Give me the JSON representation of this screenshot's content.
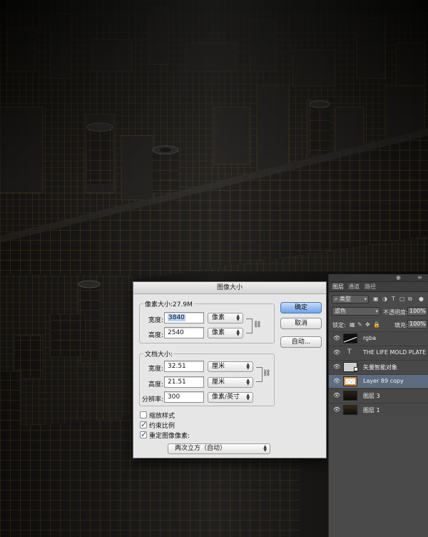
{
  "image_size_dialog": {
    "title": "图像大小",
    "pixel_dimensions_label": "像素大小:27.9M",
    "pixel_width_label": "宽度:",
    "pixel_width_value": "3840",
    "pixel_width_unit": "像素",
    "pixel_height_label": "高度:",
    "pixel_height_value": "2540",
    "pixel_height_unit": "像素",
    "document_size_label": "文档大小:",
    "doc_width_label": "宽度:",
    "doc_width_value": "32.51",
    "doc_width_unit": "厘米",
    "doc_height_label": "高度:",
    "doc_height_value": "21.51",
    "doc_height_unit": "厘米",
    "resolution_label": "分辨率:",
    "resolution_value": "300",
    "resolution_unit": "像素/英寸",
    "scale_styles_label": "缩放样式",
    "scale_styles_checked": false,
    "constrain_label": "约束比例",
    "constrain_checked": true,
    "resample_label": "重定图像像素:",
    "resample_checked": true,
    "resample_method": "两次立方（自动）",
    "ok_label": "确定",
    "cancel_label": "取消",
    "auto_label": "自动..."
  },
  "layers_panel": {
    "tabs": [
      "图层",
      "通道",
      "路径"
    ],
    "kind_filter": "类型",
    "blend_mode": "滤色",
    "opacity_label": "不透明度:",
    "opacity_value": "100%",
    "lock_label": "锁定:",
    "fill_label": "填充:",
    "fill_value": "100%",
    "layers": [
      {
        "name": "rgba",
        "selected": false
      },
      {
        "name": "THE LIFE MOLD PLATE ...",
        "selected": false
      },
      {
        "name": "矢量智能对象",
        "selected": false
      },
      {
        "name": "Layer 89 copy",
        "selected": true
      },
      {
        "name": "图层 3",
        "selected": false
      },
      {
        "name": "图层 1",
        "selected": false
      }
    ]
  },
  "colors": {
    "accent_gold": "#d9a441",
    "selected_layer": "#5d6c80",
    "default_button": "#6fa4e6"
  }
}
